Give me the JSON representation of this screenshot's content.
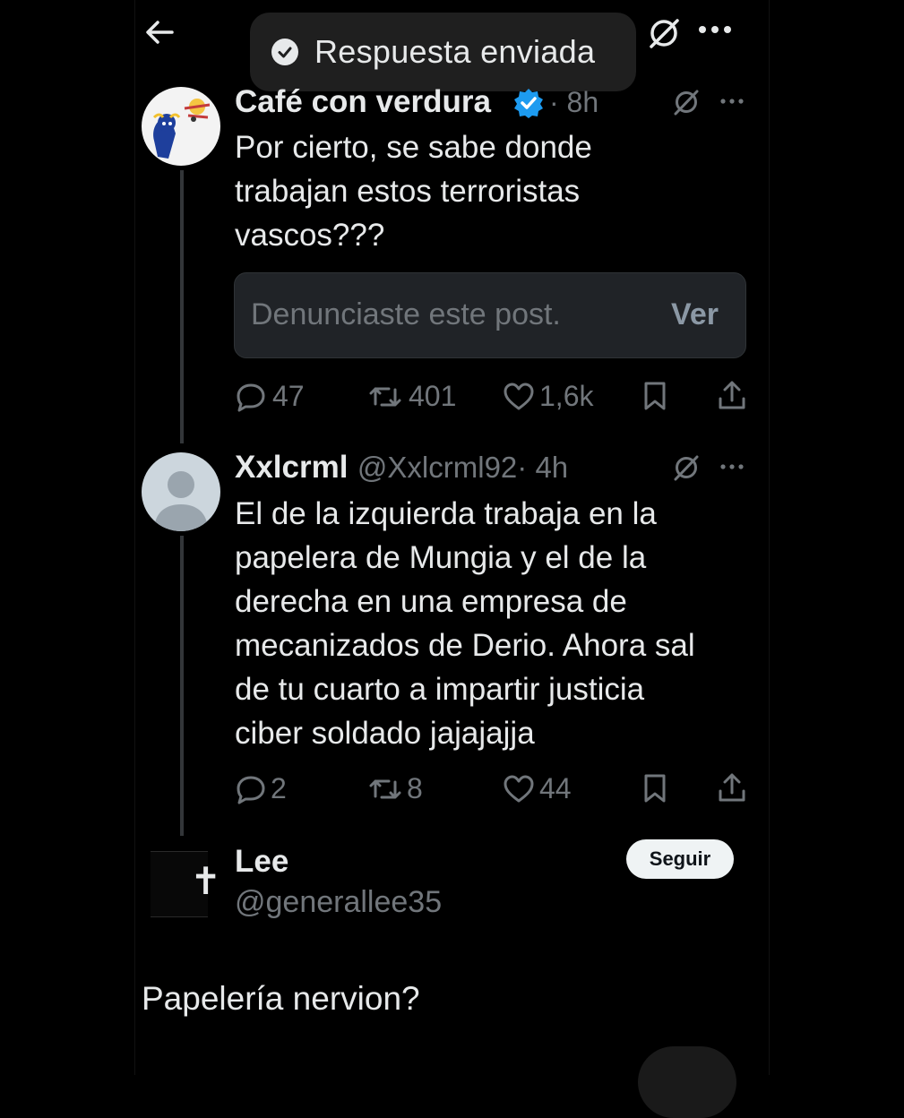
{
  "header": {
    "toast_text": "Respuesta enviada"
  },
  "tweet1": {
    "display_name": "Café con verdura",
    "time": "· 8h",
    "text_lines": [
      "Por cierto, se sabe donde",
      "trabajan estos terroristas",
      "vascos???"
    ],
    "report_notice": "Denunciaste este post.",
    "report_action": "Ver",
    "stats": {
      "replies": "47",
      "reposts": "401",
      "likes": "1,6k"
    }
  },
  "tweet2": {
    "display_name": "Xxlcrml",
    "handle": "@Xxlcrml92",
    "time": "· 4h",
    "text_lines": [
      "El de la izquierda trabaja en la",
      "papelera de Mungia y el de la",
      "derecha en una empresa de",
      "mecanizados de Derio. Ahora sal",
      "de tu cuarto a impartir justicia",
      "ciber soldado jajajajja"
    ],
    "stats": {
      "replies": "2",
      "reposts": "8",
      "likes": "44"
    }
  },
  "reply_user": {
    "display_name": "Lee",
    "handle": "@generallee35",
    "follow_label": "Seguir",
    "avatar_symbol": "✝"
  },
  "composer": {
    "text": "Papelería nervion?"
  },
  "colors": {
    "background": "#000000",
    "text": "#e7e9ea",
    "muted": "#71767b",
    "verified": "#1d9bf0"
  },
  "icons": [
    "back-arrow-icon",
    "check-circle-icon",
    "grok-icon",
    "more-icon",
    "verified-badge-icon",
    "reply-icon",
    "repost-icon",
    "like-icon",
    "bookmark-icon",
    "share-icon"
  ]
}
